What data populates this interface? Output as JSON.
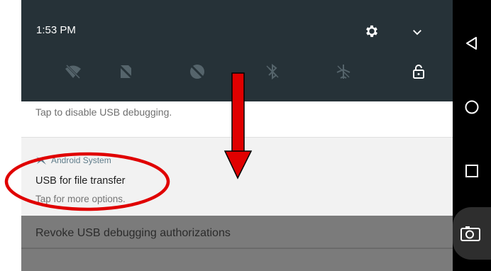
{
  "status": {
    "time": "1:53 PM"
  },
  "quick_settings": {
    "icons": [
      "wifi-off-icon",
      "no-sim-icon",
      "data-saver-icon",
      "bluetooth-off-icon",
      "airplane-mode-icon",
      "screen-lock-icon"
    ],
    "settings_icon": "gear-icon",
    "expand_icon": "chevron-down-icon"
  },
  "notifications": {
    "usb_debugging": {
      "text": "Tap to disable USB debugging."
    },
    "usb_transfer": {
      "app_name": "Android System",
      "title": "USB for file transfer",
      "subtitle": "Tap for more options."
    },
    "revoke": {
      "label": "Revoke USB debugging authorizations"
    }
  },
  "nav_bar": {
    "buttons": [
      "back-icon",
      "home-icon",
      "recents-icon",
      "screenshot-camera-icon"
    ]
  },
  "colors": {
    "quick_settings_bg": "#263238",
    "annotation_red": "#e00000",
    "app_name": "#607d8b"
  }
}
